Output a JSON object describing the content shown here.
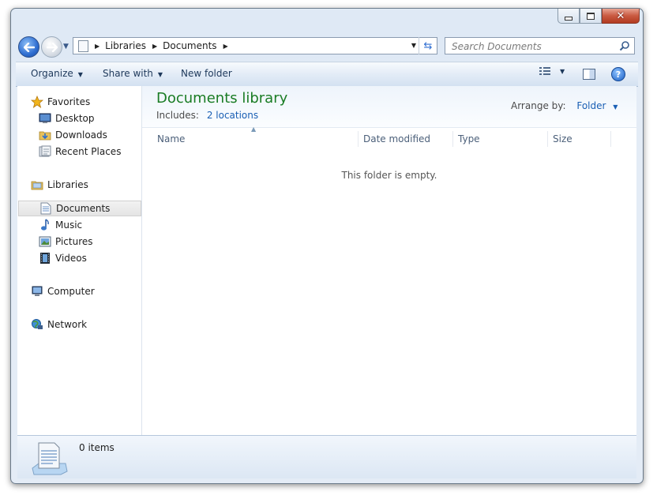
{
  "window": {
    "caption_buttons": {
      "minimize": "minimize-icon",
      "maximize": "maximize-icon",
      "close": "close-icon"
    }
  },
  "navigation": {
    "breadcrumbs": [
      "Libraries",
      "Documents"
    ],
    "search_placeholder": "Search Documents"
  },
  "toolbar": {
    "organize": "Organize",
    "share_with": "Share with",
    "new_folder": "New folder"
  },
  "sidebar": {
    "favorites": {
      "label": "Favorites",
      "items": [
        {
          "label": "Desktop",
          "icon": "desktop-icon"
        },
        {
          "label": "Downloads",
          "icon": "downloads-icon"
        },
        {
          "label": "Recent Places",
          "icon": "recent-places-icon"
        }
      ]
    },
    "libraries": {
      "label": "Libraries",
      "items": [
        {
          "label": "Documents",
          "icon": "documents-icon",
          "selected": true
        },
        {
          "label": "Music",
          "icon": "music-icon"
        },
        {
          "label": "Pictures",
          "icon": "pictures-icon"
        },
        {
          "label": "Videos",
          "icon": "videos-icon"
        }
      ]
    },
    "computer": {
      "label": "Computer"
    },
    "network": {
      "label": "Network"
    }
  },
  "library": {
    "title": "Documents library",
    "includes_label": "Includes:",
    "includes_link": "2 locations",
    "arrange_label": "Arrange by:",
    "arrange_value": "Folder"
  },
  "columns": [
    "Name",
    "Date modified",
    "Type",
    "Size"
  ],
  "empty_message": "This folder is empty.",
  "status": {
    "item_count": "0 items"
  },
  "colors": {
    "title_green": "#1a7c24",
    "link_blue": "#1a5fb4"
  }
}
